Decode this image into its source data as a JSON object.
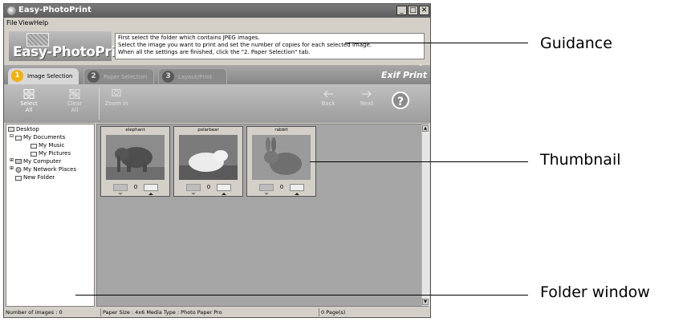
{
  "window": {
    "title": "Easy-PhotoPrint",
    "controls": {
      "minimize": "_",
      "maximize": "□",
      "close": "✕"
    }
  },
  "menu": [
    "File",
    "View",
    "Help"
  ],
  "logo": {
    "text": "Easy-PhotoPrint"
  },
  "guidance": [
    "First select the folder which contains JPEG images.",
    "Select the image you want to print and set the number of copies for each selected image.",
    "When all the settings are finished, click the \"2. Paper Selection\" tab."
  ],
  "tabs": [
    {
      "num": "1",
      "label": "Image Selection",
      "active": true
    },
    {
      "num": "2",
      "label": "Paper Selection",
      "active": false
    },
    {
      "num": "3",
      "label": "Layout/Print",
      "active": false
    }
  ],
  "brand": {
    "exif": "Exif Print",
    "collapse_glyph": "⌃"
  },
  "toolbar": {
    "select_all": {
      "line1": "Select",
      "line2": "All"
    },
    "clear_all": {
      "line1": "Clear",
      "line2": "All"
    },
    "zoom_in": "Zoom in",
    "back": "Back",
    "next": "Next",
    "help": "?"
  },
  "tree": {
    "desktop": "Desktop",
    "my_documents": "My Documents",
    "my_music": "My Music",
    "my_pictures": "My Pictures",
    "my_computer": "My Computer",
    "my_network": "My Network Places",
    "new_folder": "New Folder"
  },
  "thumbnails": [
    {
      "name": "elephant",
      "count": "0",
      "icon": "elephant-photo"
    },
    {
      "name": "polarbear",
      "count": "0",
      "icon": "polar-bear-photo"
    },
    {
      "name": "rabbit",
      "count": "0",
      "icon": "rabbit-photo"
    }
  ],
  "status": {
    "images": "Number of images : 0",
    "paper": "Paper Size : 4x6  Media Type : Photo Paper Pro",
    "pages": "0 Page(s)"
  },
  "callouts": {
    "guidance": "Guidance",
    "thumbnail": "Thumbnail",
    "folder": "Folder window"
  },
  "colors": {
    "accent_tab": "#f4b000",
    "content_bg": "#a5a5a5",
    "chrome": "#d4d0c8"
  }
}
